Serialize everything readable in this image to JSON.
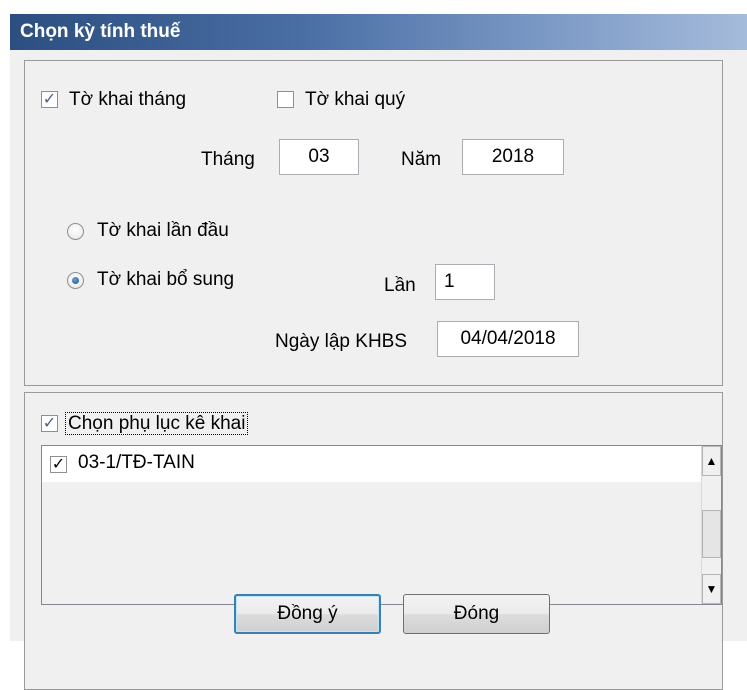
{
  "dialog": {
    "title": "Chọn kỳ tính thuế"
  },
  "period": {
    "monthly_label": "Tờ khai tháng",
    "monthly_checked": true,
    "quarterly_label": "Tờ khai quý",
    "quarterly_checked": false,
    "month_label": "Tháng",
    "month_value": "03",
    "year_label": "Năm",
    "year_value": "2018",
    "first_label": "Tờ khai lần đầu",
    "supplement_label": "Tờ khai bổ sung",
    "selected_type": "supplement",
    "times_label": "Lần",
    "times_value": "1",
    "date_label": "Ngày lập KHBS",
    "date_value": "04/04/2018"
  },
  "appendix": {
    "label": "Chọn phụ lục kê khai",
    "checked": true,
    "items": [
      {
        "label": "03-1/TĐ-TAIN",
        "checked": true
      }
    ]
  },
  "buttons": {
    "ok_label": "Đồng ý",
    "close_label": "Đóng"
  },
  "icons": {
    "check": "checkmark-icon",
    "scroll_up": "scroll-up-arrow-icon",
    "scroll_down": "scroll-down-arrow-icon"
  },
  "colors": {
    "title_bar_start": "#2c4e80",
    "title_bar_end": "#a5bbdb",
    "dialog_bg": "#f0f0f0",
    "default_button_border": "#3c7fb1"
  }
}
